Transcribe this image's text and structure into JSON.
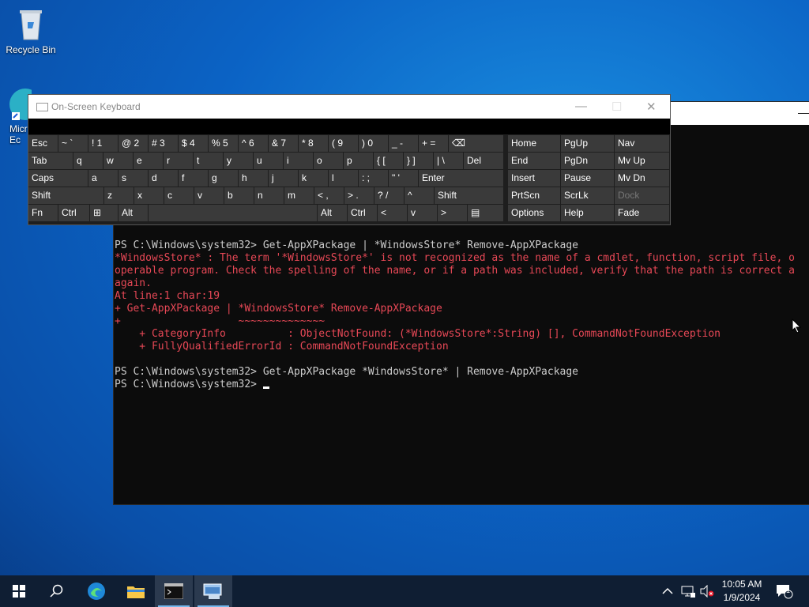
{
  "desktop": {
    "icons": [
      {
        "label": "Recycle Bin"
      },
      {
        "label": "Micr\nEc"
      }
    ]
  },
  "osk": {
    "title": "On-Screen Keyboard",
    "rows": [
      [
        "Esc",
        "~ `",
        "! 1",
        "@ 2",
        "# 3",
        "$ 4",
        "% 5",
        "^ 6",
        "& 7",
        "* 8",
        "( 9",
        ") 0",
        "_ -",
        "+ =",
        "⌫"
      ],
      [
        "Tab",
        "q",
        "w",
        "e",
        "r",
        "t",
        "y",
        "u",
        "i",
        "o",
        "p",
        "{ [",
        "} ]",
        "| \\",
        "Del"
      ],
      [
        "Caps",
        "a",
        "s",
        "d",
        "f",
        "g",
        "h",
        "j",
        "k",
        "l",
        ": ;",
        "\" '",
        "Enter"
      ],
      [
        "Shift",
        "z",
        "x",
        "c",
        "v",
        "b",
        "n",
        "m",
        "< ,",
        "> .",
        "? /",
        "^",
        "Shift"
      ],
      [
        "Fn",
        "Ctrl",
        "⊞",
        "Alt",
        "",
        "Alt",
        "Ctrl",
        "<",
        "v",
        ">",
        "▤"
      ]
    ],
    "nav_keys": [
      [
        "Home",
        "PgUp",
        "Nav"
      ],
      [
        "End",
        "PgDn",
        "Mv Up"
      ],
      [
        "Insert",
        "Pause",
        "Mv Dn"
      ],
      [
        "PrtScn",
        "ScrLk",
        "Dock"
      ],
      [
        "Options",
        "Help",
        "Fade"
      ]
    ]
  },
  "console": {
    "lines": [
      {
        "text": "PS C:\\Windows\\system32> Get-AppXPackage | *WindowsStore* Remove-AppXPackage",
        "color": "normal"
      },
      {
        "text": "*WindowsStore* : The term '*WindowsStore*' is not recognized as the name of a cmdlet, function, script file, o",
        "color": "red"
      },
      {
        "text": "operable program. Check the spelling of the name, or if a path was included, verify that the path is correct a",
        "color": "red"
      },
      {
        "text": "again.",
        "color": "red"
      },
      {
        "text": "At line:1 char:19",
        "color": "red"
      },
      {
        "text": "+ Get-AppXPackage | *WindowsStore* Remove-AppXPackage",
        "color": "red"
      },
      {
        "text": "+                   ~~~~~~~~~~~~~~",
        "color": "red"
      },
      {
        "text": "    + CategoryInfo          : ObjectNotFound: (*WindowsStore*:String) [], CommandNotFoundException",
        "color": "red"
      },
      {
        "text": "    + FullyQualifiedErrorId : CommandNotFoundException",
        "color": "red"
      },
      {
        "text": "",
        "color": "normal"
      },
      {
        "text": "PS C:\\Windows\\system32> Get-AppXPackage *WindowsStore* | Remove-AppXPackage",
        "color": "normal"
      },
      {
        "text": "PS C:\\Windows\\system32> ",
        "color": "normal"
      }
    ]
  },
  "taskbar": {
    "clock_time": "10:05 AM",
    "clock_date": "1/9/2024",
    "notification_count": "1"
  }
}
